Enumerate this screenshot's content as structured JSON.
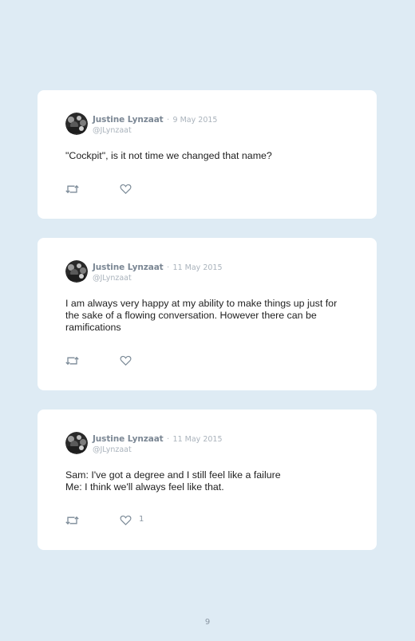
{
  "tweets": [
    {
      "name": "Justine Lynzaat",
      "separator": "·",
      "date": "9 May 2015",
      "handle": "@JLynzaat",
      "text": "\"Cockpit\", is it not time we changed that name?",
      "likes": ""
    },
    {
      "name": "Justine Lynzaat",
      "separator": "·",
      "date": "11 May 2015",
      "handle": "@JLynzaat",
      "text": "I am always very happy at my ability to make things up just for the sake of a flowing conversation. However there can be ramifications",
      "likes": ""
    },
    {
      "name": "Justine Lynzaat",
      "separator": "·",
      "date": "11 May 2015",
      "handle": "@JLynzaat",
      "text": "Sam: I've got a degree and I still feel like a failure\nMe: I think we'll always feel like that.",
      "likes": "1"
    }
  ],
  "page": {
    "number": "9"
  },
  "icons": {
    "retweet": "retweet-icon",
    "like": "heart-icon",
    "avatar": "profile-photo"
  },
  "colors": {
    "background": "#deebf4",
    "card": "#ffffff",
    "name": "#7b8794",
    "muted": "#aab3bc",
    "text": "#222222"
  }
}
